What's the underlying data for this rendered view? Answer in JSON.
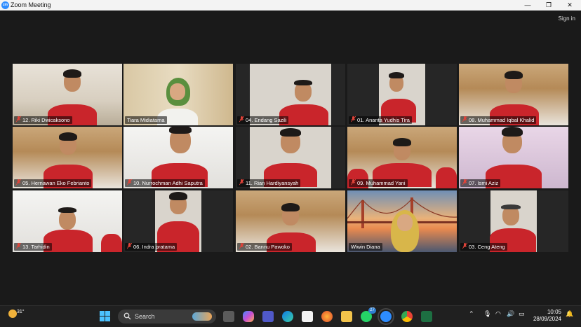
{
  "window": {
    "title": "Zoom Meeting",
    "logo_text": "zm",
    "signin_label": "Sign in",
    "minimize_glyph": "—",
    "maximize_glyph": "❐",
    "close_glyph": "✕"
  },
  "participants": [
    {
      "name": "12. Riki Dwicaksono",
      "muted": true,
      "active": false
    },
    {
      "name": "Tiara Midiatama",
      "muted": false,
      "active": true
    },
    {
      "name": "04. Endang Sazili",
      "muted": true,
      "active": false
    },
    {
      "name": "01. Ananta Yudhis Tira",
      "muted": true,
      "active": false
    },
    {
      "name": "08. Muhammad Iqbal Khalid",
      "muted": true,
      "active": false
    },
    {
      "name": "05. Hernawan Eko Febrianto",
      "muted": true,
      "active": false
    },
    {
      "name": "10. Nurrochman Adhi Saputra",
      "muted": true,
      "active": false
    },
    {
      "name": "11. Rian Hardiyansyah",
      "muted": true,
      "active": false
    },
    {
      "name": "09. Muhammad Yani",
      "muted": true,
      "active": false
    },
    {
      "name": "07. Ismi Aziz",
      "muted": true,
      "active": false
    },
    {
      "name": "13. Tarhidin",
      "muted": true,
      "active": false
    },
    {
      "name": "06. Indra pratama",
      "muted": true,
      "active": false
    },
    {
      "name": "02. Bannu Pawoko",
      "muted": true,
      "active": false
    },
    {
      "name": "Wiwin Diana",
      "muted": false,
      "active": false
    },
    {
      "name": "03. Ceng Ateng",
      "muted": true,
      "active": false
    }
  ],
  "taskbar": {
    "weather_temp": "31°",
    "search_label": "Search",
    "whatsapp_badge": "27",
    "time": "10:05",
    "date": "28/09/2024"
  },
  "colors": {
    "active_speaker": "#c4e84a",
    "uniform_red": "#c9252b",
    "muted_icon": "#e0443a"
  }
}
